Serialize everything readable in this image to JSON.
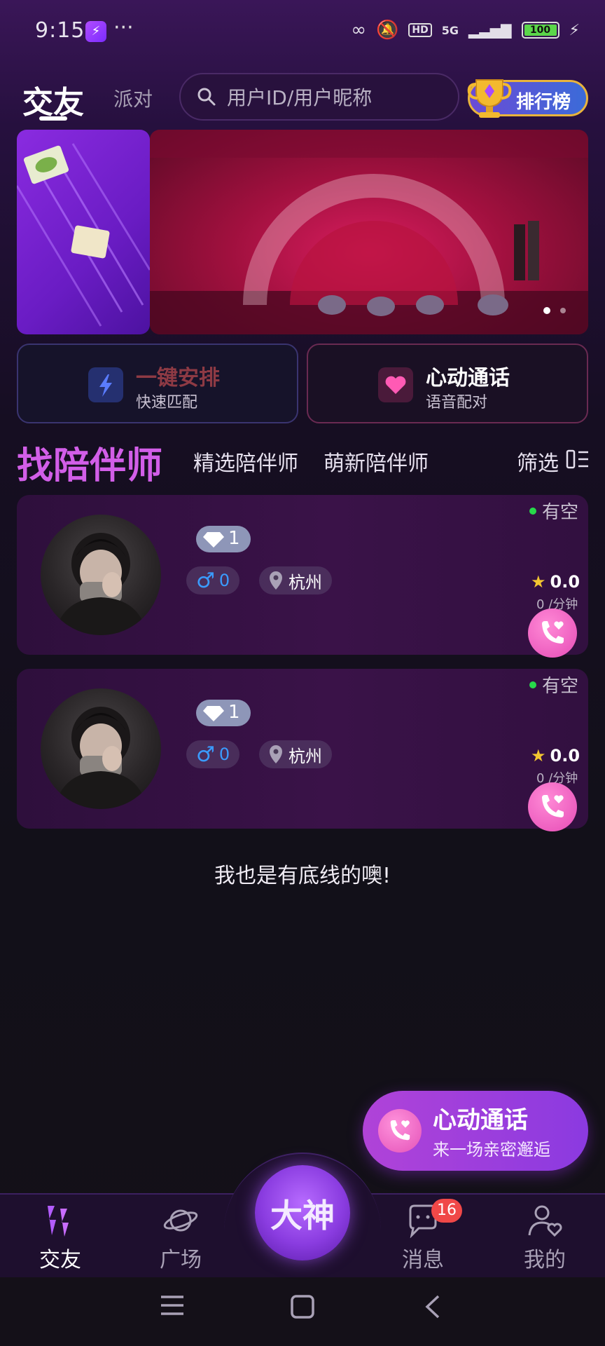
{
  "status_bar": {
    "time": "9:15",
    "app_badge_text": "⚡",
    "more": "···",
    "hd": "HD",
    "network": "5G",
    "battery": "100"
  },
  "top_nav": {
    "active_tab": "交友",
    "inactive_tab": "派对",
    "search_placeholder": "用户ID/用户昵称",
    "ranking_label": "排行榜"
  },
  "quick_actions": [
    {
      "title": "一键安排",
      "subtitle": "快速匹配",
      "title_color": "#8e3a44",
      "icon": "lightning-icon"
    },
    {
      "title": "心动通话",
      "subtitle": "语音配对",
      "title_color": "#ffffff",
      "icon": "heart-icon"
    }
  ],
  "section": {
    "title": "找陪伴师",
    "tabs": [
      "精选陪伴师",
      "萌新陪伴师"
    ],
    "filter_label": "筛选"
  },
  "companions": [
    {
      "status": "有空",
      "level": "1",
      "gender_count": "0",
      "city": "杭州",
      "rating": "0.0",
      "price": "0 /分钟"
    },
    {
      "status": "有空",
      "level": "1",
      "gender_count": "0",
      "city": "杭州",
      "rating": "0.0",
      "price": "0 /分钟"
    }
  ],
  "footer_text": "我也是有底线的噢!",
  "promo": {
    "title": "心动通话",
    "subtitle": "来一场亲密邂逅"
  },
  "bottom_nav": {
    "items": [
      "交友",
      "广场",
      "消息",
      "我的"
    ],
    "center_label": "大神",
    "message_badge": "16"
  },
  "colors": {
    "accent_purple": "#d25ee8",
    "status_green": "#27d84a",
    "badge_red": "#f04848"
  }
}
